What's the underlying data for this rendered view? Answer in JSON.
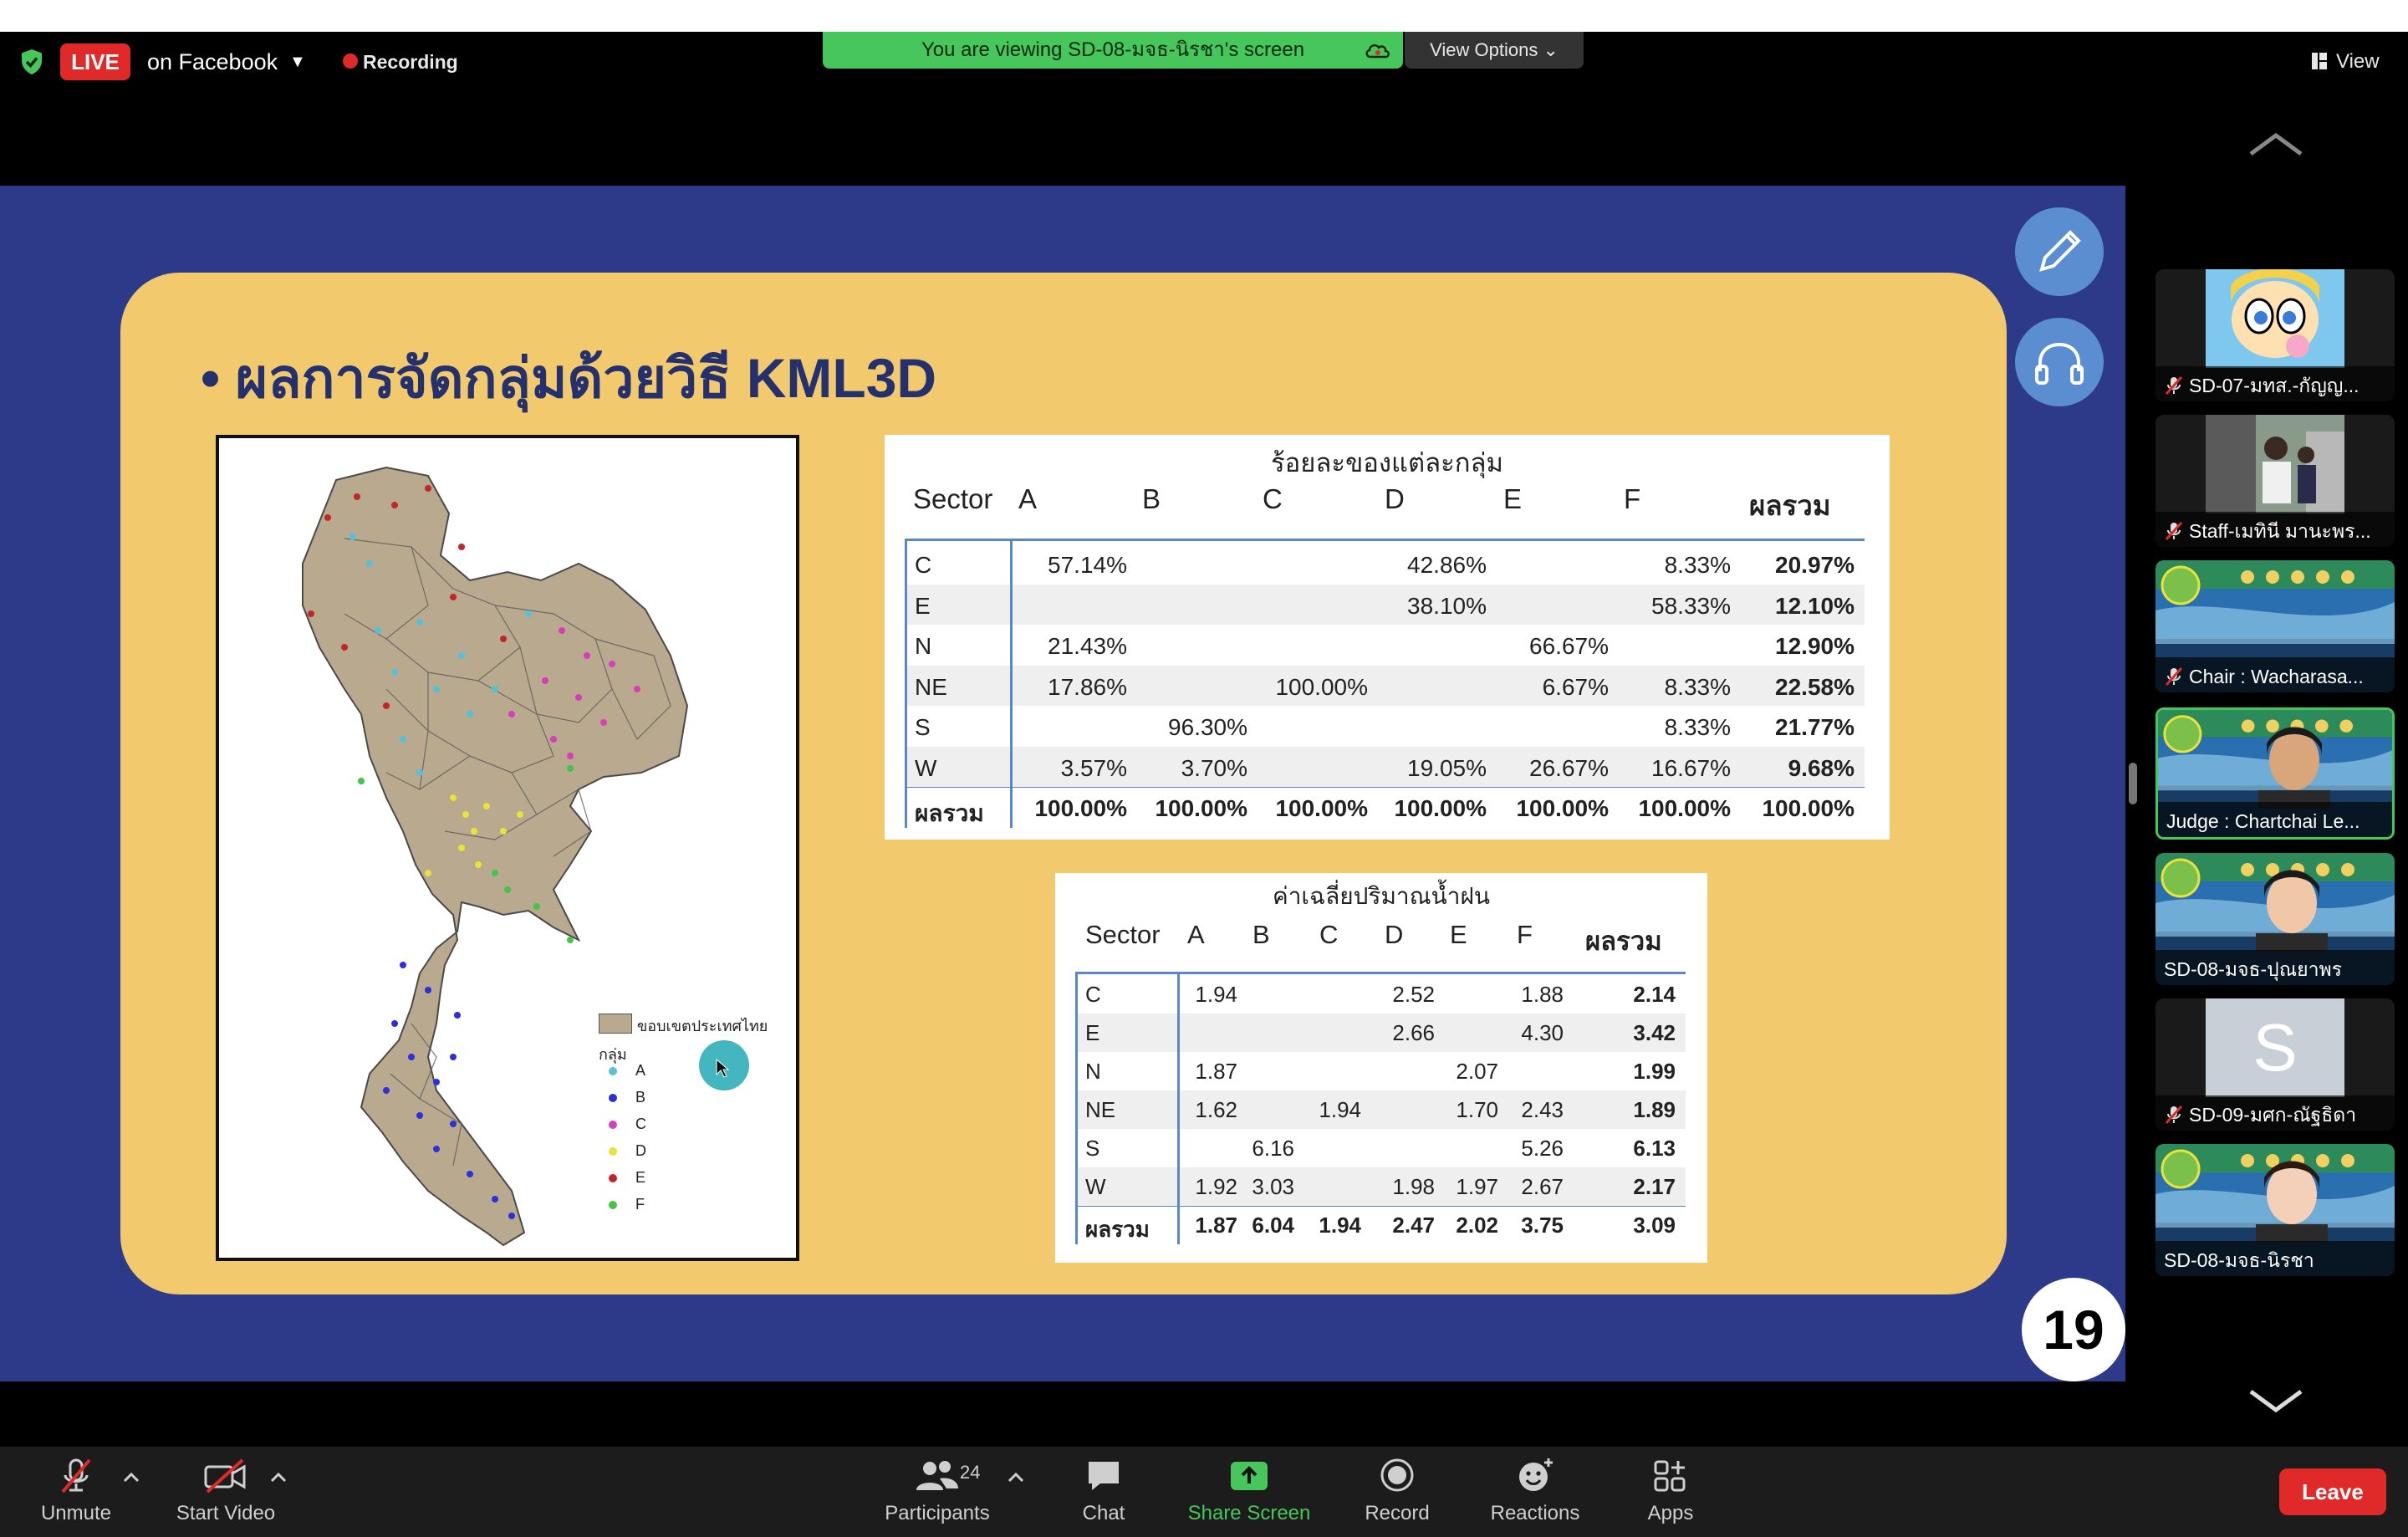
{
  "topbar": {
    "live_badge": "LIVE",
    "live_destination": "on Facebook",
    "recording_label": "Recording",
    "viewing_banner": "You are viewing SD-08-มจธ-นิรชา's screen",
    "view_options_label": "View Options",
    "view_label": "View"
  },
  "slide": {
    "title": "• ผลการจัดกลุ่มด้วยวิธี KML3D",
    "page_number": "19",
    "map_legend": {
      "boundary_label": "ขอบเขตประเทศไทย",
      "group_label": "กลุ่ม",
      "items": [
        {
          "label": "A",
          "color": "#57c0d8"
        },
        {
          "label": "B",
          "color": "#2d2fd8"
        },
        {
          "label": "C",
          "color": "#d63fb8"
        },
        {
          "label": "D",
          "color": "#e8e23a"
        },
        {
          "label": "E",
          "color": "#c02828"
        },
        {
          "label": "F",
          "color": "#47c24a"
        }
      ]
    },
    "percent_table": {
      "title": "ร้อยละของแต่ละกลุ่ม",
      "headers": [
        "Sector",
        "A",
        "B",
        "C",
        "D",
        "E",
        "F",
        "ผลรวม"
      ],
      "rows": [
        [
          "C",
          "57.14%",
          "",
          "",
          "42.86%",
          "",
          "8.33%",
          "20.97%"
        ],
        [
          "E",
          "",
          "",
          "",
          "38.10%",
          "",
          "58.33%",
          "12.10%"
        ],
        [
          "N",
          "21.43%",
          "",
          "",
          "",
          "66.67%",
          "",
          "12.90%"
        ],
        [
          "NE",
          "17.86%",
          "",
          "100.00%",
          "",
          "6.67%",
          "8.33%",
          "22.58%"
        ],
        [
          "S",
          "",
          "96.30%",
          "",
          "",
          "",
          "8.33%",
          "21.77%"
        ],
        [
          "W",
          "3.57%",
          "3.70%",
          "",
          "19.05%",
          "26.67%",
          "16.67%",
          "9.68%"
        ]
      ],
      "total_row": [
        "ผลรวม",
        "100.00%",
        "100.00%",
        "100.00%",
        "100.00%",
        "100.00%",
        "100.00%",
        "100.00%"
      ]
    },
    "rain_table": {
      "title": "ค่าเฉลี่ยปริมาณน้ำฝน",
      "headers": [
        "Sector",
        "A",
        "B",
        "C",
        "D",
        "E",
        "F",
        "ผลรวม"
      ],
      "rows": [
        [
          "C",
          "1.94",
          "",
          "",
          "2.52",
          "",
          "1.88",
          "2.14"
        ],
        [
          "E",
          "",
          "",
          "",
          "2.66",
          "",
          "4.30",
          "3.42"
        ],
        [
          "N",
          "1.87",
          "",
          "",
          "",
          "2.07",
          "",
          "1.99"
        ],
        [
          "NE",
          "1.62",
          "",
          "1.94",
          "",
          "1.70",
          "2.43",
          "1.89"
        ],
        [
          "S",
          "",
          "6.16",
          "",
          "",
          "",
          "5.26",
          "6.13"
        ],
        [
          "W",
          "1.92",
          "3.03",
          "",
          "1.98",
          "1.97",
          "2.67",
          "2.17"
        ]
      ],
      "total_row": [
        "ผลรวม",
        "1.87",
        "6.04",
        "1.94",
        "2.47",
        "2.02",
        "3.75",
        "3.09"
      ]
    }
  },
  "participants_panel": {
    "tiles": [
      {
        "name": "SD-07-มทส.-กัญญ...",
        "muted": true
      },
      {
        "name": "Staff-เมทินี มานะพร...",
        "muted": true
      },
      {
        "name": "Chair : Wacharasa...",
        "muted": true
      },
      {
        "name": "Judge : Chartchai Le...",
        "muted": false,
        "active": true
      },
      {
        "name": "SD-08-มจธ-ปุณยาพร",
        "muted": false
      },
      {
        "name": "SD-09-มศก-ณัฐธิดา",
        "muted": true,
        "initial": "S"
      },
      {
        "name": "SD-08-มจธ-นิรชา",
        "muted": false
      }
    ]
  },
  "toolbar": {
    "unmute": "Unmute",
    "start_video": "Start Video",
    "participants": "Participants",
    "participants_count": "24",
    "chat": "Chat",
    "share_screen": "Share Screen",
    "record": "Record",
    "reactions": "Reactions",
    "apps": "Apps",
    "leave": "Leave"
  },
  "colors": {
    "live_red": "#e02a2a",
    "zoom_green": "#47c65c",
    "slide_blue": "#2d3a8a",
    "card_yellow": "#f2c96d",
    "title_navy": "#25306e",
    "table_rule": "#5a87c6"
  }
}
